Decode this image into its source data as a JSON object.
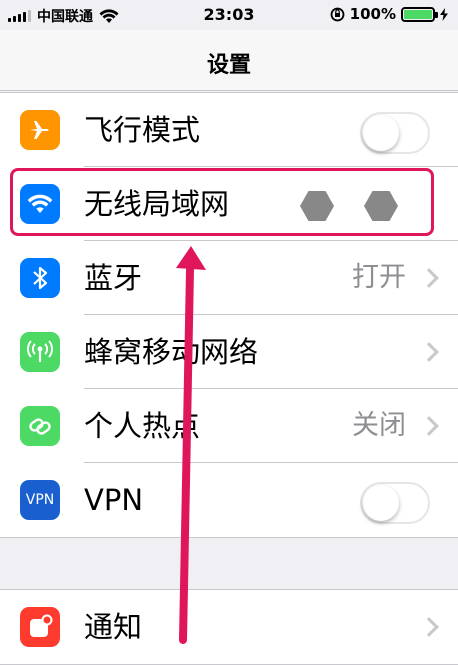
{
  "status_bar": {
    "carrier": "中国联通",
    "time": "23:03",
    "battery_percent": "100%",
    "battery_level": 1.0
  },
  "nav": {
    "title": "设置"
  },
  "settings": {
    "airplane": {
      "label": "飞行模式",
      "icon": "airplane-icon",
      "color": "#ff9500",
      "toggle_on": false
    },
    "wifi": {
      "label": "无线局域网",
      "icon": "wifi-icon",
      "color": "#007aff"
    },
    "bluetooth": {
      "label": "蓝牙",
      "value": "打开",
      "icon": "bluetooth-icon",
      "color": "#007aff"
    },
    "cellular": {
      "label": "蜂窝移动网络",
      "icon": "cellular-antenna-icon",
      "color": "#4cd964"
    },
    "hotspot": {
      "label": "个人热点",
      "value": "关闭",
      "icon": "hotspot-link-icon",
      "color": "#4cd964"
    },
    "vpn": {
      "label": "VPN",
      "icon_text": "VPN",
      "color": "#1a5fd0",
      "toggle_on": false
    },
    "notifications": {
      "label": "通知",
      "icon": "notifications-icon",
      "color": "#ff3b30"
    }
  },
  "annotation": {
    "highlight_color": "#e0165c"
  }
}
